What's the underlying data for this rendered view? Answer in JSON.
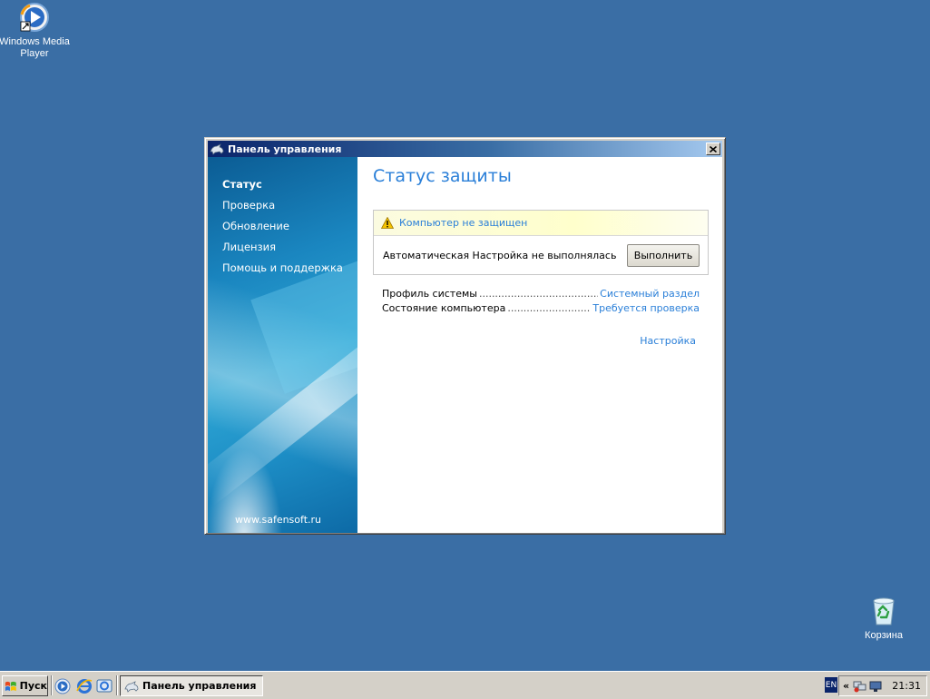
{
  "desktop": {
    "icons": [
      {
        "label": "Windows Media Player"
      },
      {
        "label": "Корзина"
      }
    ]
  },
  "window": {
    "title": "Панель управления",
    "sidebar": {
      "items": [
        {
          "label": "Статус",
          "active": true
        },
        {
          "label": "Проверка"
        },
        {
          "label": "Обновление"
        },
        {
          "label": "Лицензия"
        },
        {
          "label": "Помощь и поддержка"
        }
      ],
      "website": "www.safensoft.ru"
    },
    "main": {
      "heading": "Статус защиты",
      "alert": {
        "status": "Компьютер не защищен",
        "message": "Автоматическая Настройка не выполнялась",
        "action_label": "Выполнить"
      },
      "info": [
        {
          "label": "Профиль системы",
          "value": "Системный раздел"
        },
        {
          "label": "Состояние компьютера",
          "value": "Требуется проверка"
        }
      ],
      "settings_link": "Настройка"
    }
  },
  "taskbar": {
    "start_label": "Пуск",
    "task_label": "Панель управления",
    "language": "EN",
    "clock": "21:31"
  },
  "colors": {
    "desktop": "#3a6ea5",
    "link": "#2a7fd8",
    "title_gradient_start": "#0a246a"
  }
}
